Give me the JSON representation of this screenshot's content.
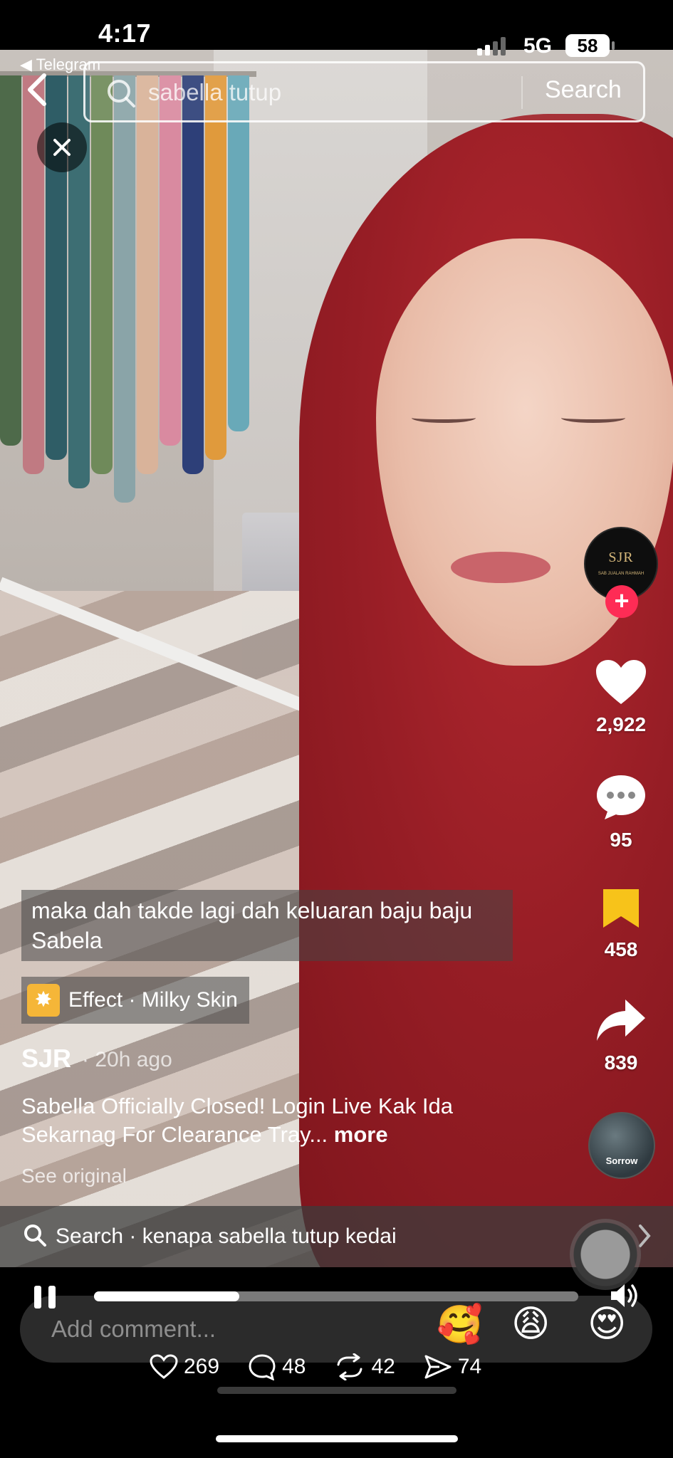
{
  "status_bar": {
    "time": "4:17",
    "network": "5G",
    "battery": "58"
  },
  "telegram_back": "◀ Telegram",
  "search": {
    "query": "sabella tutup",
    "submit_label": "Search"
  },
  "video": {
    "overlay_text": "maka dah takde lagi dah keluaran baju baju Sabela",
    "effect_label": "Effect · Milky Skin",
    "author": "SJR",
    "time_ago": "· 20h ago",
    "description": "Sabella Officially Closed! Login Live Kak Ida Sekarnag For Clearance Tray...",
    "more_label": "more",
    "see_original": "See original"
  },
  "creator_avatar": {
    "monogram": "SJR",
    "caption": "SAB JUALAN RAHMAH"
  },
  "actions": {
    "likes": "2,922",
    "comments": "95",
    "saves": "458",
    "shares": "839"
  },
  "music_disc_label": "Sorrow",
  "related_search": "Search · kenapa sabella tutup kedai",
  "comment": {
    "placeholder": "Add comment...",
    "emojis": [
      "🥰",
      "😩",
      "😍"
    ]
  },
  "video_progress": 0.3,
  "bottom_stats": {
    "likes": "269",
    "comments": "48",
    "reposts": "42",
    "shares": "74"
  }
}
